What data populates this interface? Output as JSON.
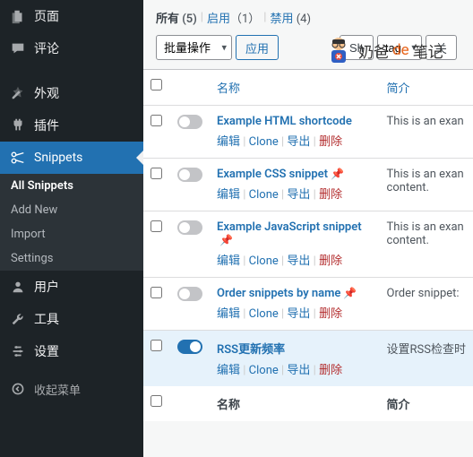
{
  "sidebar": {
    "items": [
      {
        "label": "页面",
        "icon": "pages-icon"
      },
      {
        "label": "评论",
        "icon": "comments-icon"
      },
      {
        "label": "外观",
        "icon": "appearance-icon"
      },
      {
        "label": "插件",
        "icon": "plugins-icon"
      },
      {
        "label": "Snippets",
        "icon": "snippets-icon"
      },
      {
        "label": "用户",
        "icon": "users-icon"
      },
      {
        "label": "工具",
        "icon": "tools-icon"
      },
      {
        "label": "设置",
        "icon": "settings-icon"
      }
    ],
    "submenu": [
      "All Snippets",
      "Add New",
      "Import",
      "Settings"
    ],
    "collapse": "收起菜单"
  },
  "filters": {
    "all": "所有",
    "all_count": "(5)",
    "enabled": "启用",
    "enabled_count": "（1）",
    "disabled": "禁用",
    "disabled_count": "(4)"
  },
  "bulk": {
    "select": "批量操作",
    "apply": "应用",
    "show_btn": "Sh",
    "all_tags": "tag",
    "filter": "关"
  },
  "table": {
    "col_name": "名称",
    "col_desc": "简介",
    "actions": {
      "edit": "编辑",
      "clone": "Clone",
      "export": "导出",
      "delete": "删除"
    }
  },
  "rows": [
    {
      "title": "Example HTML shortcode",
      "desc": "This is an exan",
      "active": false,
      "pin": false
    },
    {
      "title": "Example CSS snippet",
      "desc": "This is an exan content.",
      "active": false,
      "pin": true
    },
    {
      "title": "Example JavaScript snippet",
      "desc": "This is an exan content.",
      "active": false,
      "pin": true
    },
    {
      "title": "Order snippets by name",
      "desc": "Order snippet:",
      "active": false,
      "pin": true
    },
    {
      "title": "RSS更新频率",
      "desc": "设置RSS检查时",
      "active": true,
      "pin": false
    }
  ],
  "watermark": {
    "t1": "奶爸",
    "de": "de",
    "t2": "笔记"
  }
}
